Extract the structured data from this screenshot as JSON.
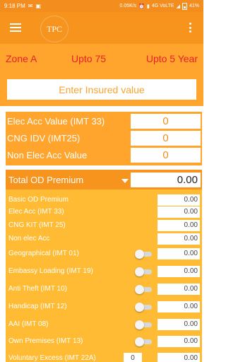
{
  "status_bar": {
    "time": "9:18 PM",
    "speed": "0.05K/s",
    "network": "4G VoLTE",
    "battery": "41%"
  },
  "app_bar": {
    "logo_text": "TPC",
    "menu_icon": "hamburger-menu-icon",
    "overflow_icon": "more-vert-icon"
  },
  "zone_bar": {
    "zone": "Zone A",
    "cc": "Upto 75",
    "age": "Upto 5 Year",
    "text_color": "#e8202a"
  },
  "insured": {
    "placeholder": "Enter Insured value"
  },
  "addons": [
    {
      "label": "Elec Acc Value (IMT 33)",
      "value": "0"
    },
    {
      "label": "CNG IDV (IMT25)",
      "value": "0"
    },
    {
      "label": "Non Elec Acc Value",
      "value": "0"
    }
  ],
  "od_premium": {
    "title": "Total OD Premium",
    "value": "0.00",
    "rows": [
      {
        "label": "Basic OD Premium",
        "value": "0.00"
      },
      {
        "label": "Elec Acc (IMT 33)",
        "value": "0.00"
      },
      {
        "label": "CNG KIT (IMT 25)",
        "value": "0.00"
      },
      {
        "label": "Non elec Acc",
        "value": "0.00"
      },
      {
        "label": "Geographical (IMT 01)",
        "value": "0.00"
      },
      {
        "label": "Embassy Loading (IMT 19)",
        "value": "0.00"
      },
      {
        "label": "Anti Theft (IMT 10)",
        "value": "0.00"
      },
      {
        "label": "Handicap (IMT 12)",
        "value": "0.00"
      },
      {
        "label": "AAI (IMT 08)",
        "value": "0.00"
      },
      {
        "label": "Own Premises (IMT 13)",
        "value": "0.00"
      },
      {
        "label": "Voluntary Excess (IMT 22A)",
        "value": "0.00",
        "input": "0"
      }
    ]
  },
  "colors": {
    "status_bar": "#f28d1e",
    "app_bar": "#f7941e",
    "panel": "#ffa52e",
    "od_panel": "#ffbb33"
  }
}
